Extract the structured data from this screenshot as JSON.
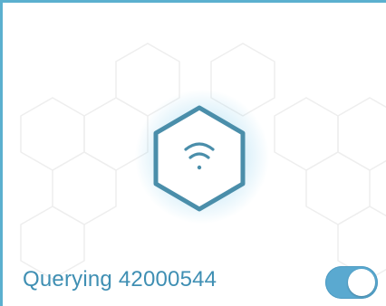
{
  "status": {
    "text": "Querying 42000544"
  },
  "center_icon": {
    "icon": "wifi-icon",
    "frame": "hexagon"
  },
  "toggle": {
    "state": "on"
  },
  "colors": {
    "accent": "#5bb0cf",
    "text": "#3f8fb3",
    "hex_stroke": "#4a8eaa",
    "toggle_on": "#5aa9d0"
  }
}
